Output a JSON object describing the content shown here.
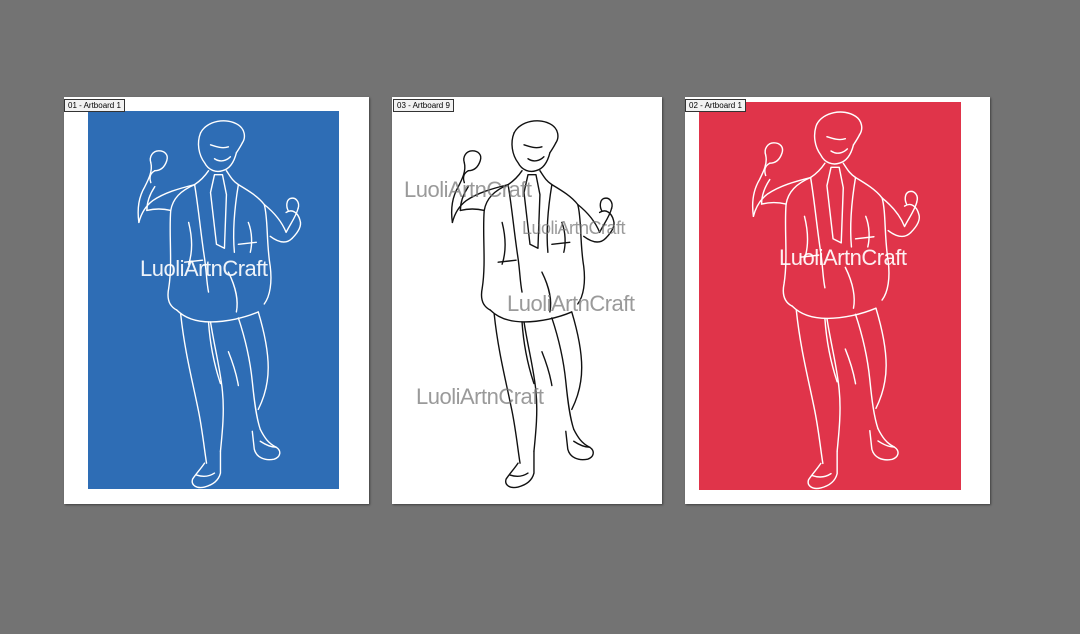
{
  "canvas": {
    "background": "#737373"
  },
  "artboards": [
    {
      "label": "01 - Artboard 1",
      "fill": "#2e6db5",
      "line_color": "#ffffff"
    },
    {
      "label": "03 - Artboard 9",
      "fill": "#ffffff",
      "line_color": "#111111"
    },
    {
      "label": "02 - Artboard 1",
      "fill": "#e0344a",
      "line_color": "#ffffff"
    }
  ],
  "watermark": "LuoliArtnCraft"
}
